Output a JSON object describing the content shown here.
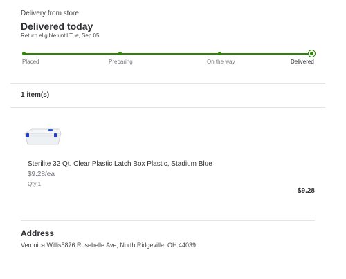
{
  "header": {
    "delivery_type": "Delivery from store",
    "status": "Delivered today",
    "return_note": "Return eligible until Tue, Sep 05"
  },
  "progress": {
    "steps": [
      "Placed",
      "Preparing",
      "On the way",
      "Delivered"
    ],
    "current_step": "Delivered",
    "accent_color": "#2a8703"
  },
  "items": {
    "count_label": "1 item(s)",
    "list": [
      {
        "name": "Sterilite 32 Qt. Clear Plastic Latch Box Plastic, Stadium Blue",
        "unit_price": "$9.28/ea",
        "qty": "Qty 1",
        "total": "$9.28",
        "thumbnail_icon": "storage-box-icon"
      }
    ]
  },
  "address": {
    "heading": "Address",
    "text": "Veronica Willis5876 Rosebelle Ave, North Ridgeville, OH 44039"
  }
}
